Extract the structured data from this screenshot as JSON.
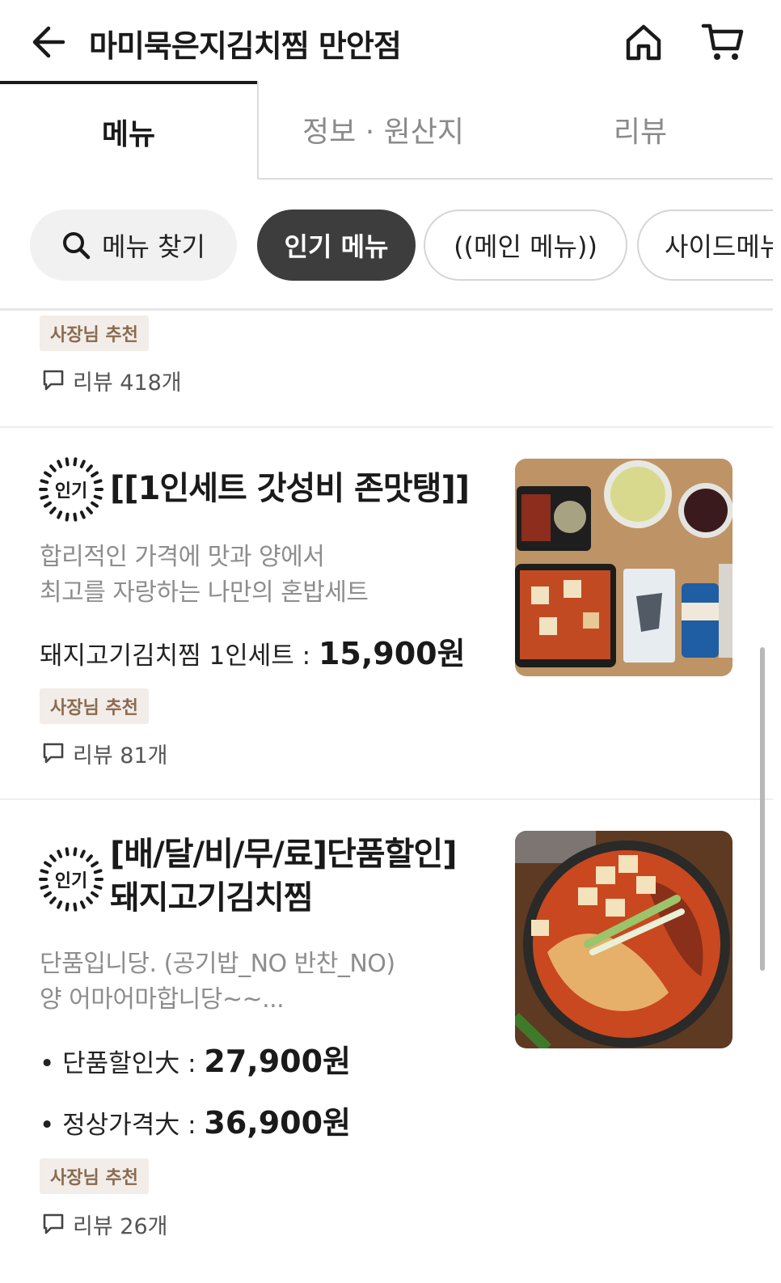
{
  "header": {
    "title": "마미묵은지김치찜 만안점",
    "back_icon": "arrow-left-icon",
    "home_icon": "home-icon",
    "cart_icon": "cart-icon"
  },
  "tabs": [
    {
      "label": "메뉴",
      "active": true
    },
    {
      "label": "정보 · 원산지",
      "active": false
    },
    {
      "label": "리뷰",
      "active": false
    }
  ],
  "chips": {
    "search_label": "메뉴 찾기",
    "items": [
      "인기 메뉴",
      "((메인 메뉴))",
      "사이드메뉴"
    ],
    "active": "인기 메뉴"
  },
  "colors": {
    "active_chip": "#3d3d3d",
    "badge_bg": "#f2ede8",
    "badge_text": "#8a6a4f"
  },
  "partial_item": {
    "badge": "사장님 추천",
    "reviews": "리뷰 418개"
  },
  "items": [
    {
      "popular_label": "인기",
      "name": "[[1인세트 갓성비 존맛탱]]",
      "desc_lines": [
        "합리적인 가격에 맛과 양에서",
        "최고를 자랑하는 나만의 혼밥세트"
      ],
      "prices": [
        {
          "label": "돼지고기김치찜 1인세트 : ",
          "value": "15,900원"
        }
      ],
      "badge": "사장님 추천",
      "reviews": "리뷰 81개"
    },
    {
      "popular_label": "인기",
      "name_lines": [
        "[배/달/비/무/료]단품할인]",
        "돼지고기김치찜"
      ],
      "desc_lines": [
        "단품입니당. (공기밥_NO 반찬_NO)",
        "양 어마어마합니당~~..."
      ],
      "prices": [
        {
          "label": "• 단품할인大 : ",
          "value": "27,900원"
        },
        {
          "label": "• 정상가격大 : ",
          "value": "36,900원"
        }
      ],
      "badge": "사장님 추천",
      "reviews": "리뷰 26개"
    }
  ]
}
